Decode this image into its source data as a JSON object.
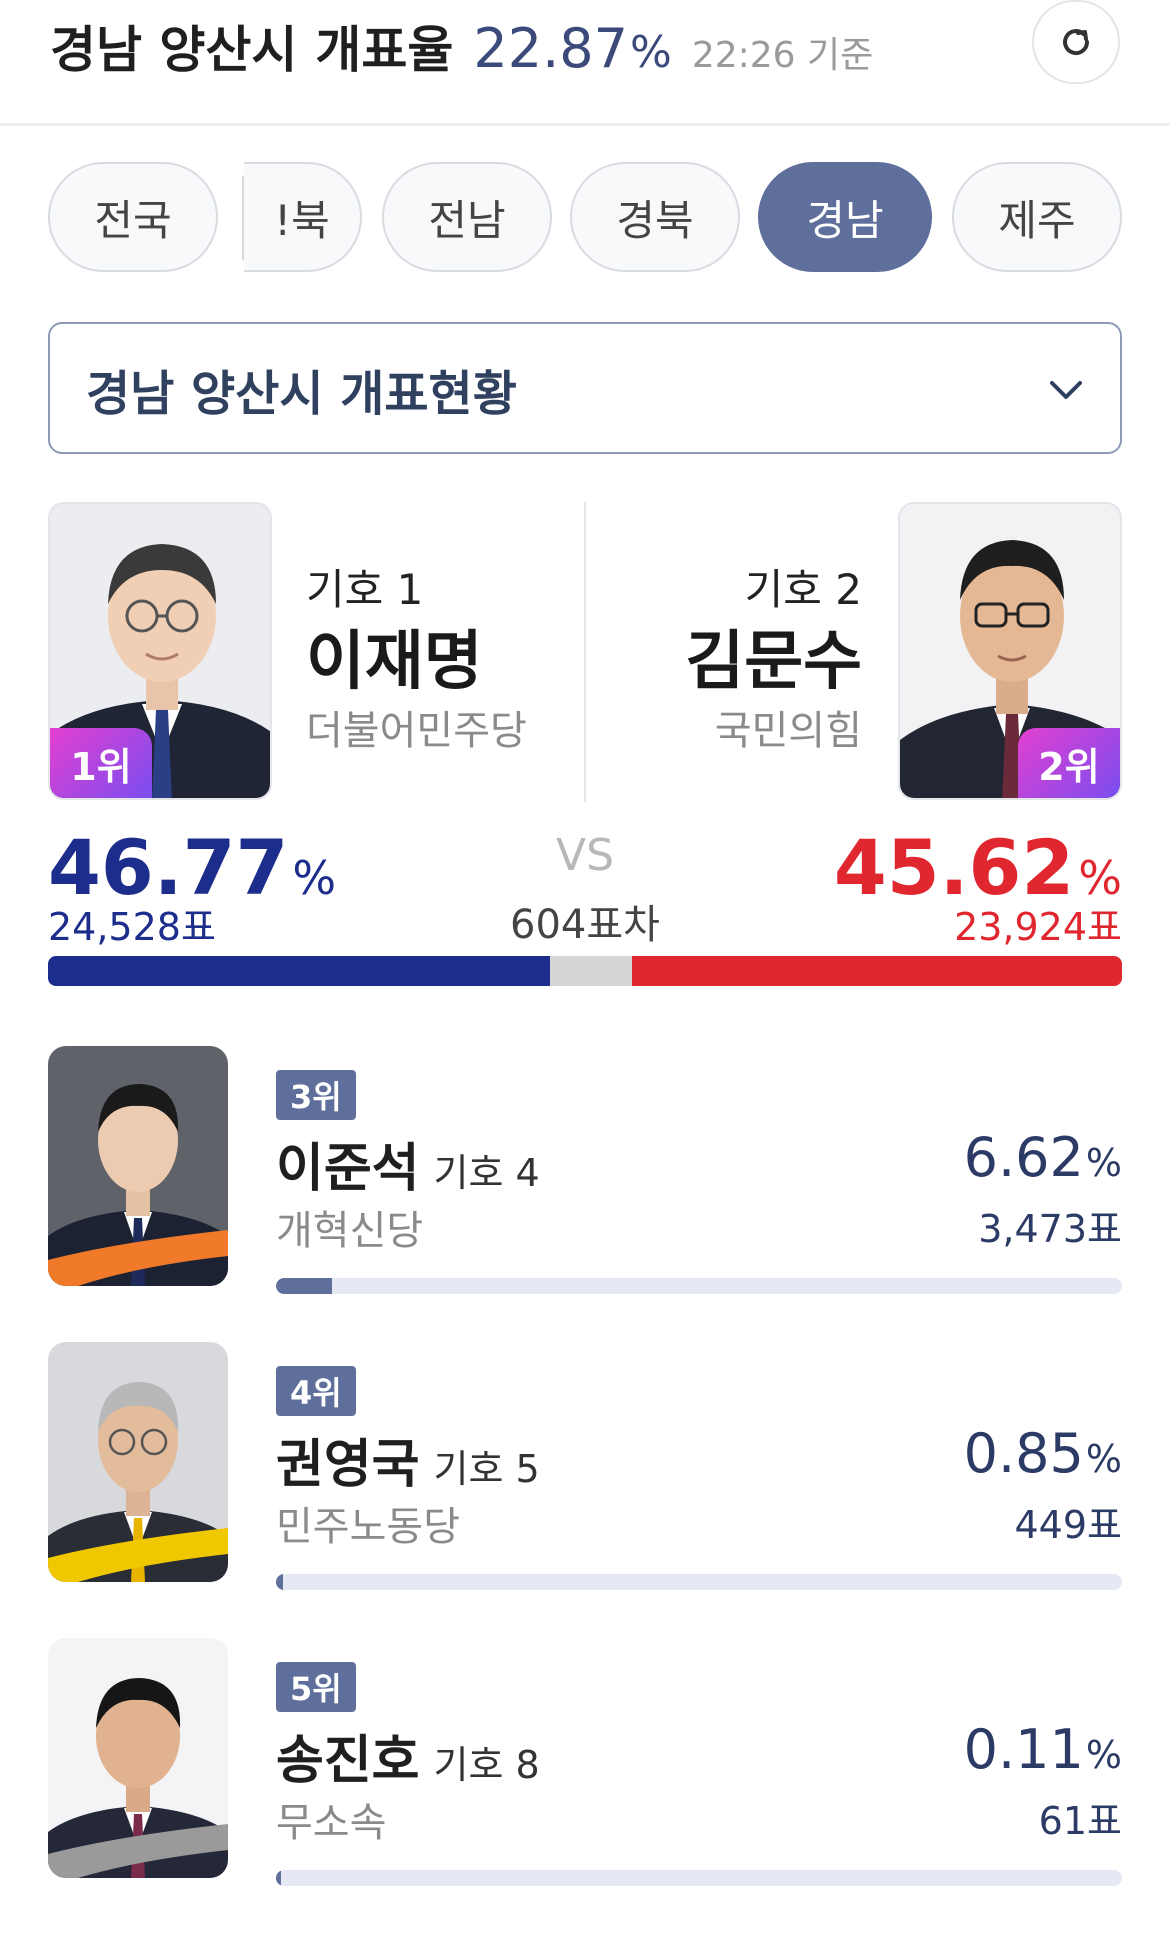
{
  "header": {
    "region": "경남 양산시",
    "label": "개표율",
    "rate": "22.87",
    "rate_unit": "%",
    "time": "22:26 기준",
    "refresh_icon": "refresh-icon"
  },
  "tabs": [
    {
      "label": "전국"
    },
    {
      "label": "!북"
    },
    {
      "label": "전남"
    },
    {
      "label": "경북"
    },
    {
      "label": "경남",
      "active": true
    },
    {
      "label": "제주"
    }
  ],
  "dropdown": {
    "label": "경남 양산시 개표현황",
    "icon": "chevron-down-icon"
  },
  "top_candidates": {
    "first": {
      "number_label": "기호 1",
      "name": "이재명",
      "party": "더불어민주당",
      "rank": "1위",
      "percent": "46.77",
      "unit": "%",
      "votes": "24,528표",
      "vote_share": 46.77
    },
    "second": {
      "number_label": "기호 2",
      "name": "김문수",
      "party": "국민의힘",
      "rank": "2위",
      "percent": "45.62",
      "unit": "%",
      "votes": "23,924표",
      "vote_share": 45.62
    },
    "vs": "VS",
    "difference": "604표차"
  },
  "other_candidates": [
    {
      "rank": "3위",
      "name": "이준석",
      "number_label": "기호 4",
      "party": "개혁신당",
      "percent": "6.62",
      "unit": "%",
      "votes": "3,473표",
      "vote_share": 6.62
    },
    {
      "rank": "4위",
      "name": "권영국",
      "number_label": "기호 5",
      "party": "민주노동당",
      "percent": "0.85",
      "unit": "%",
      "votes": "449표",
      "vote_share": 0.85
    },
    {
      "rank": "5위",
      "name": "송진호",
      "number_label": "기호 8",
      "party": "무소속",
      "percent": "0.11",
      "unit": "%",
      "votes": "61표",
      "vote_share": 0.11
    }
  ],
  "colors": {
    "first_party": "#1d2d8c",
    "second_party": "#e0262e",
    "accent": "#5f6f9b",
    "row_accent_3": "#f07a2a",
    "row_accent_4": "#f0c800",
    "row_accent_5": "#9a9a9a"
  }
}
